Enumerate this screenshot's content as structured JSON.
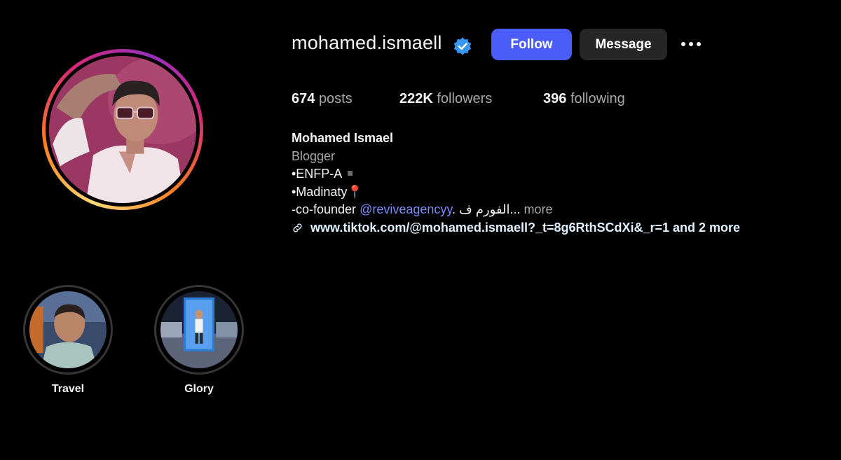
{
  "profile": {
    "username": "mohamed.ismaell",
    "verified_icon": "verified-badge-icon",
    "avatar_alt": "profile-photo"
  },
  "actions": {
    "follow_label": "Follow",
    "message_label": "Message",
    "more_icon": "more-options-icon"
  },
  "stats": {
    "posts_count": "674",
    "posts_label": "posts",
    "followers_count": "222K",
    "followers_label": "followers",
    "following_count": "396",
    "following_label": "following"
  },
  "bio": {
    "full_name": "Mohamed Ismael",
    "category": "Blogger",
    "line1": "•ENFP-A",
    "line2": "•Madinaty",
    "line2_emoji": "📍",
    "line3_prefix": "-co-founder ",
    "line3_mention": "@reviveagencyy",
    "line3_suffix": ". الفورم ف...",
    "more_label": " more",
    "link_text": "www.tiktok.com/@mohamed.ismaell?_t=8g6RthSCdXi&_r=1 and 2 more"
  },
  "highlights": [
    {
      "label": "Travel"
    },
    {
      "label": "Glory"
    }
  ],
  "colors": {
    "background": "#000000",
    "follow_button": "#4a5df9",
    "message_button": "#262626",
    "verified": "#3897f0",
    "mention": "#7b8cff"
  }
}
